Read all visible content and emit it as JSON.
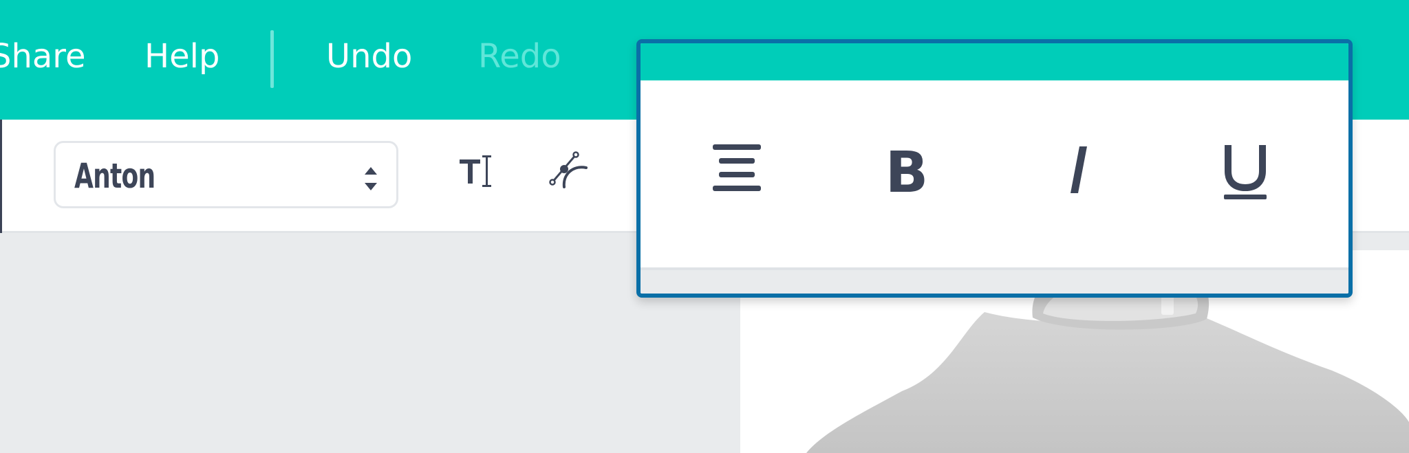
{
  "header": {
    "nav": [
      {
        "label": "Share",
        "enabled": true
      },
      {
        "label": "Help",
        "enabled": true
      },
      {
        "label": "Undo",
        "enabled": true
      },
      {
        "label": "Redo",
        "enabled": false
      }
    ]
  },
  "toolbar": {
    "font_select": {
      "value": "Anton",
      "icon": "updown-caret-icon"
    },
    "tools": [
      {
        "name": "text-cursor-tool",
        "icon": "text-cursor-icon"
      },
      {
        "name": "curve-path-tool",
        "icon": "bezier-curve-icon"
      }
    ]
  },
  "format_popup": {
    "buttons": [
      {
        "name": "align-center",
        "icon": "align-center-icon"
      },
      {
        "name": "bold",
        "icon": "bold-icon",
        "glyph": "B"
      },
      {
        "name": "italic",
        "icon": "italic-icon",
        "glyph": "I"
      },
      {
        "name": "underline",
        "icon": "underline-icon",
        "glyph": "U"
      }
    ],
    "highlight_color": "#0a6fa7"
  },
  "colors": {
    "brand": "#00cdb9",
    "text_dark": "#3d4558",
    "disabled_nav": "#5fe6d9"
  }
}
